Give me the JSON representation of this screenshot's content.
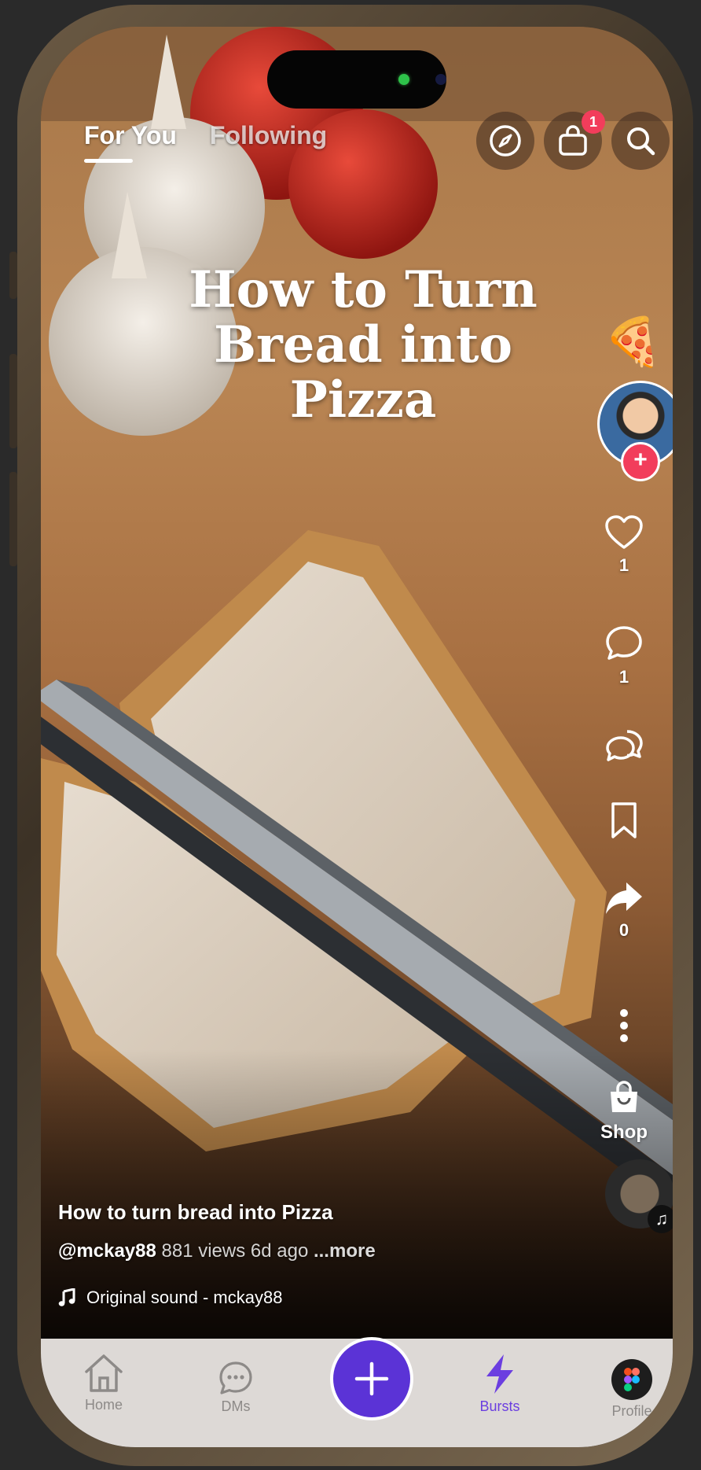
{
  "top_nav": {
    "tabs": [
      {
        "label": "For You",
        "active": true
      },
      {
        "label": "Following",
        "active": false
      }
    ],
    "cart_badge": "1"
  },
  "video": {
    "headline_line1": "How to Turn",
    "headline_line2": "Bread into Pizza",
    "headline_emoji": "🍕"
  },
  "actions": {
    "likes": "1",
    "comments": "1",
    "shares": "0",
    "shop_label": "Shop"
  },
  "caption": {
    "title": "How to turn bread into Pizza",
    "handle": "@mckay88",
    "stats": "881 views 6d ago",
    "more": "...more",
    "sound": "Original sound - mckay88"
  },
  "bottom_nav": {
    "items": [
      {
        "label": "Home",
        "icon": "home-icon"
      },
      {
        "label": "DMs",
        "icon": "chat-icon"
      },
      {
        "label": "",
        "icon": "plus-icon"
      },
      {
        "label": "Bursts",
        "icon": "bolt-icon"
      },
      {
        "label": "Profile",
        "icon": "figma-icon"
      }
    ],
    "accent": "#5b33d6"
  }
}
